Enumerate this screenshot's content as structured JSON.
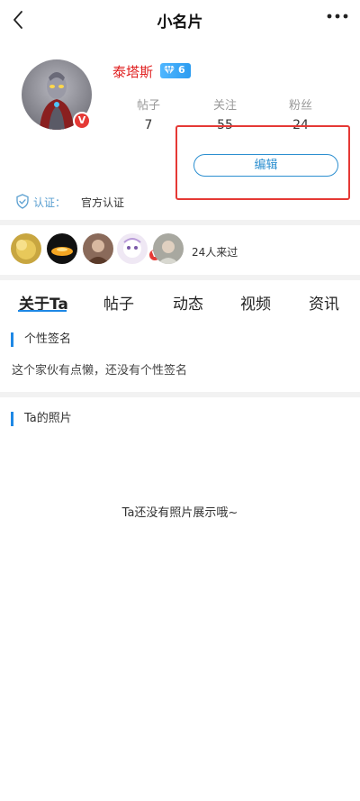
{
  "header": {
    "title": "小名片",
    "back_icon": "chevron-left-icon",
    "more_icon": "more-horizontal-icon"
  },
  "profile": {
    "username": "泰塔斯",
    "level": "6",
    "verified_badge": "V",
    "stats": [
      {
        "label": "帖子",
        "value": "7"
      },
      {
        "label": "关注",
        "value": "55"
      },
      {
        "label": "粉丝",
        "value": "24"
      }
    ],
    "edit_label": "编辑",
    "certification": {
      "key": "认证：",
      "value": "官方认证"
    }
  },
  "visitors": {
    "count_text": "24人来过",
    "badge": "V"
  },
  "tabs": [
    {
      "label": "关于Ta",
      "active": true
    },
    {
      "label": "帖子"
    },
    {
      "label": "动态"
    },
    {
      "label": "视频"
    },
    {
      "label": "资讯"
    }
  ],
  "signature": {
    "title": "个性签名",
    "text": "这个家伙有点懒，还没有个性签名"
  },
  "photos": {
    "title": "Ta的照片",
    "empty_text": "Ta还没有照片展示哦~"
  },
  "colors": {
    "accent": "#1e88e5",
    "username": "#e02020",
    "highlight_box": "#e53935"
  }
}
